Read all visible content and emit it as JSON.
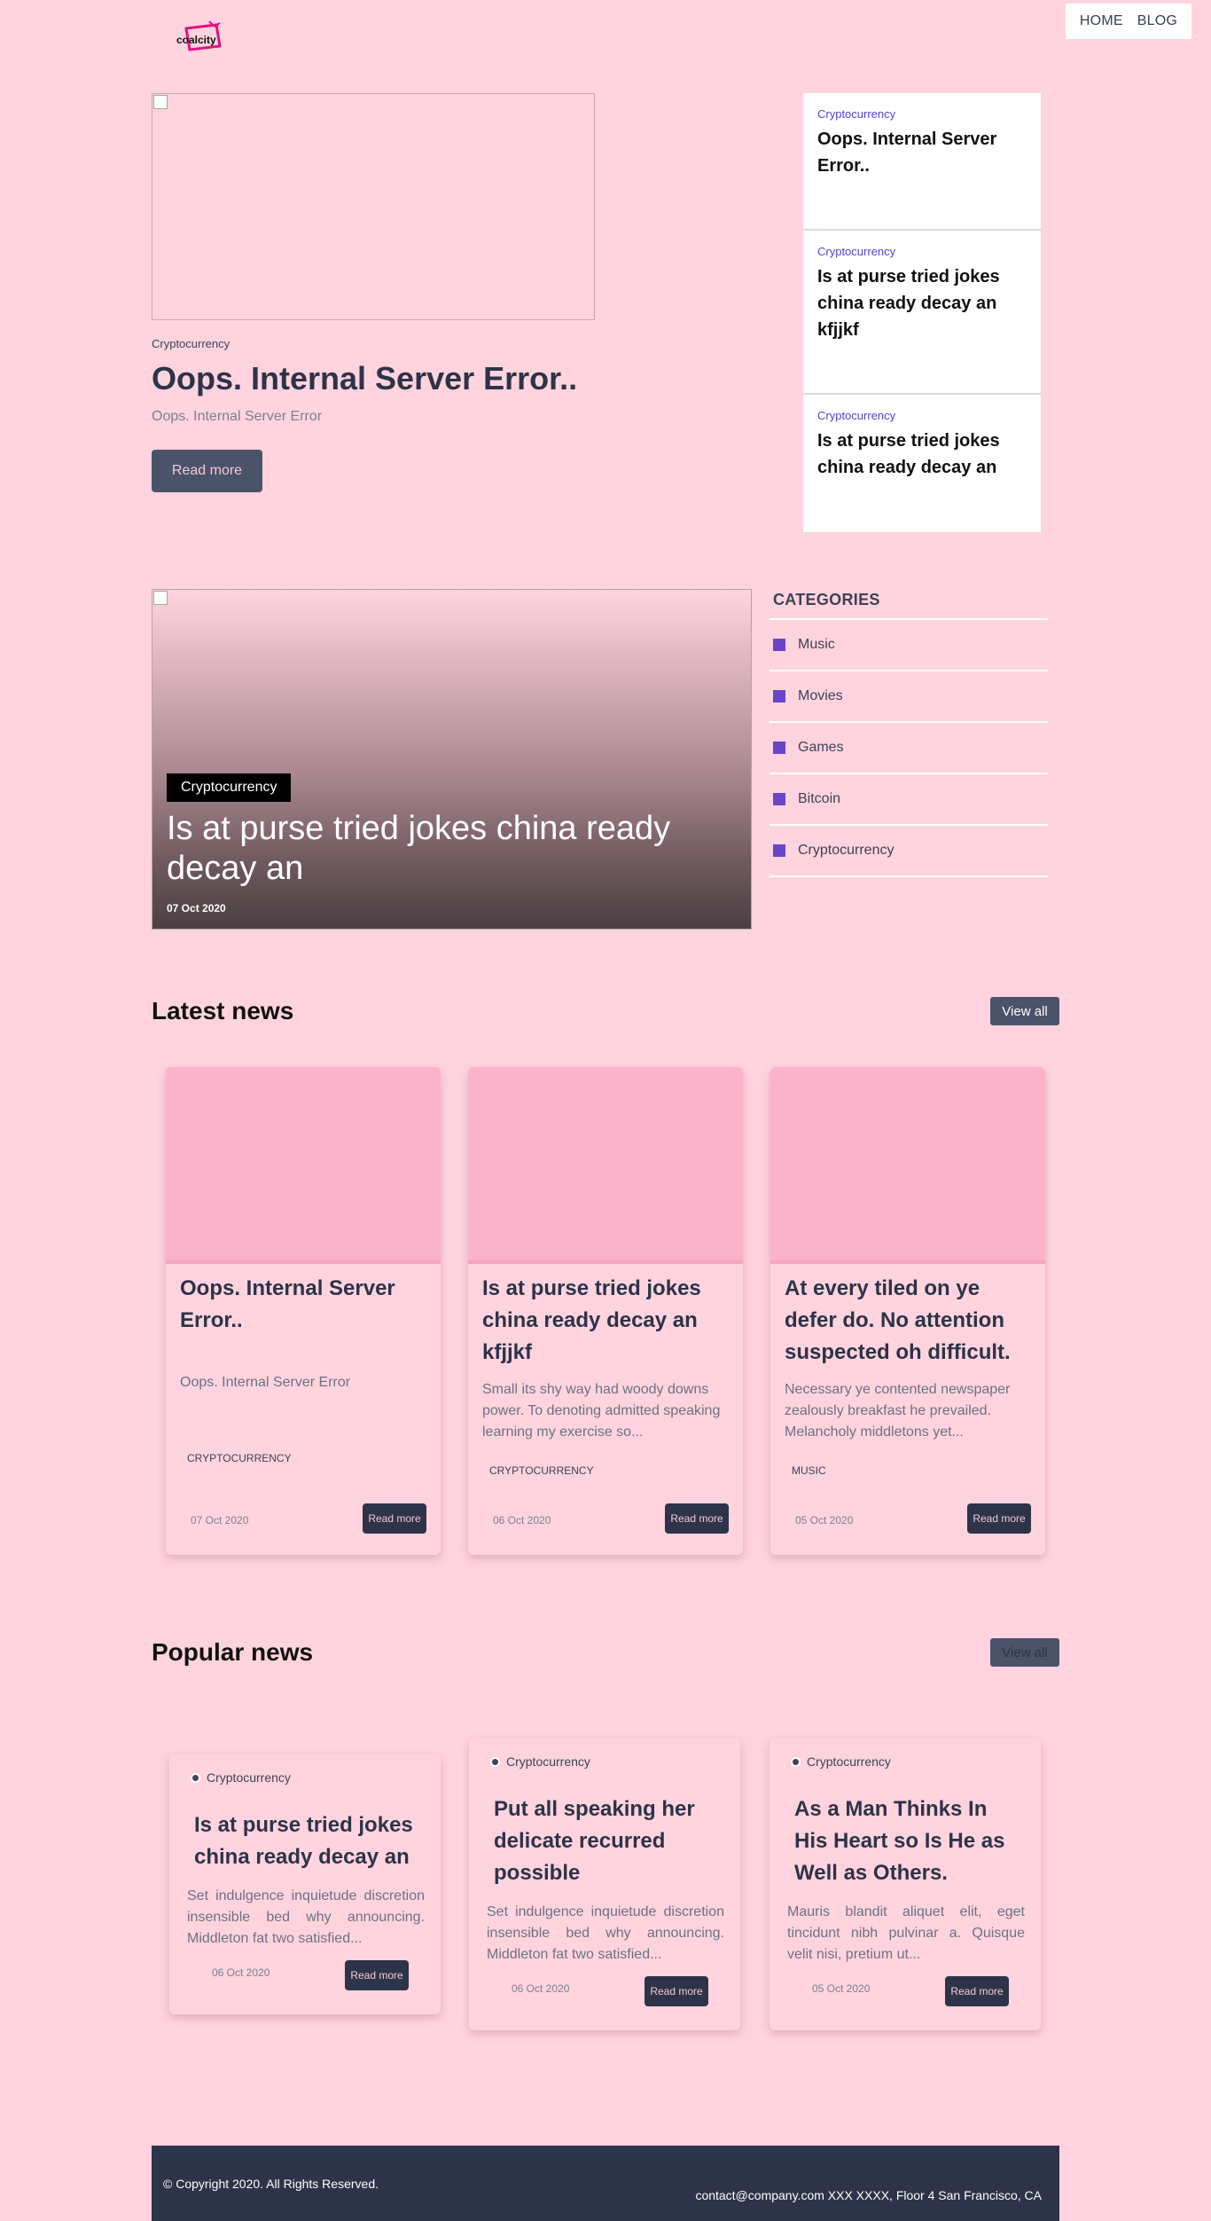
{
  "header": {
    "logo_text": "coalcity",
    "nav": [
      "HOME",
      "BLOG"
    ]
  },
  "hero": {
    "category": "Cryptocurrency",
    "title": "Oops. Internal Server Error..",
    "subtitle": "Oops. Internal Server Error",
    "button": "Read more"
  },
  "side_posts": [
    {
      "category": "Cryptocurrency",
      "title": "Oops. Internal Server Error.."
    },
    {
      "category": "Cryptocurrency",
      "title": "Is at purse tried jokes china ready decay an kfjjkf"
    },
    {
      "category": "Cryptocurrency",
      "title": "Is at purse tried jokes china ready decay an"
    }
  ],
  "featured": {
    "category": "Cryptocurrency",
    "title": "Is at purse tried jokes china ready decay an",
    "date": "07 Oct 2020"
  },
  "categories": {
    "heading": "CATEGORIES",
    "items": [
      "Music",
      "Movies",
      "Games",
      "Bitcoin",
      "Cryptocurrency"
    ],
    "accent_color": "#6a45c9"
  },
  "latest": {
    "title": "Latest news",
    "view_all": "View all",
    "cards": [
      {
        "title": "Oops. Internal Server Error..",
        "desc": "Oops. Internal Server Error",
        "tag": "CRYPTOCURRENCY",
        "date": "07 Oct 2020",
        "button": "Read more"
      },
      {
        "title": "Is at purse tried jokes china ready decay an kfjjkf",
        "desc": "Small its shy way had woody downs power. To denoting admitted speaking learning my exercise so...",
        "tag": "CRYPTOCURRENCY",
        "date": "06 Oct 2020",
        "button": "Read more"
      },
      {
        "title": "At every tiled on ye defer do. No attention suspected oh difficult.",
        "desc": "Necessary ye contented newspaper zealously breakfast he prevailed. Melancholy middletons yet...",
        "tag": "MUSIC",
        "date": "05 Oct 2020",
        "button": "Read more"
      }
    ]
  },
  "popular": {
    "title": "Popular news",
    "view_all": "View all",
    "cards": [
      {
        "category": "Cryptocurrency",
        "title": "Is at purse tried jokes china ready decay an",
        "desc": "Set indulgence inquietude discretion insensible bed why announcing. Middleton fat two satisfied...",
        "date": "06 Oct 2020",
        "button": "Read more"
      },
      {
        "category": "Cryptocurrency",
        "title": "Put all speaking her delicate recurred possible",
        "desc": "Set indulgence inquietude discretion insensible bed why announcing. Middleton fat two satisfied...",
        "date": "06 Oct 2020",
        "button": "Read more"
      },
      {
        "category": "Cryptocurrency",
        "title": "As a Man Thinks In His Heart so Is He as Well as Others.",
        "desc": "Mauris blandit aliquet elit, eget tincidunt nibh pulvinar a. Quisque velit nisi, pretium ut...",
        "date": "05 Oct 2020",
        "button": "Read more"
      }
    ]
  },
  "footer": {
    "copyright": "© Copyright 2020. All Rights Reserved.",
    "contact": "contact@company.com  XXX XXXX, Floor 4 San Francisco, CA"
  }
}
